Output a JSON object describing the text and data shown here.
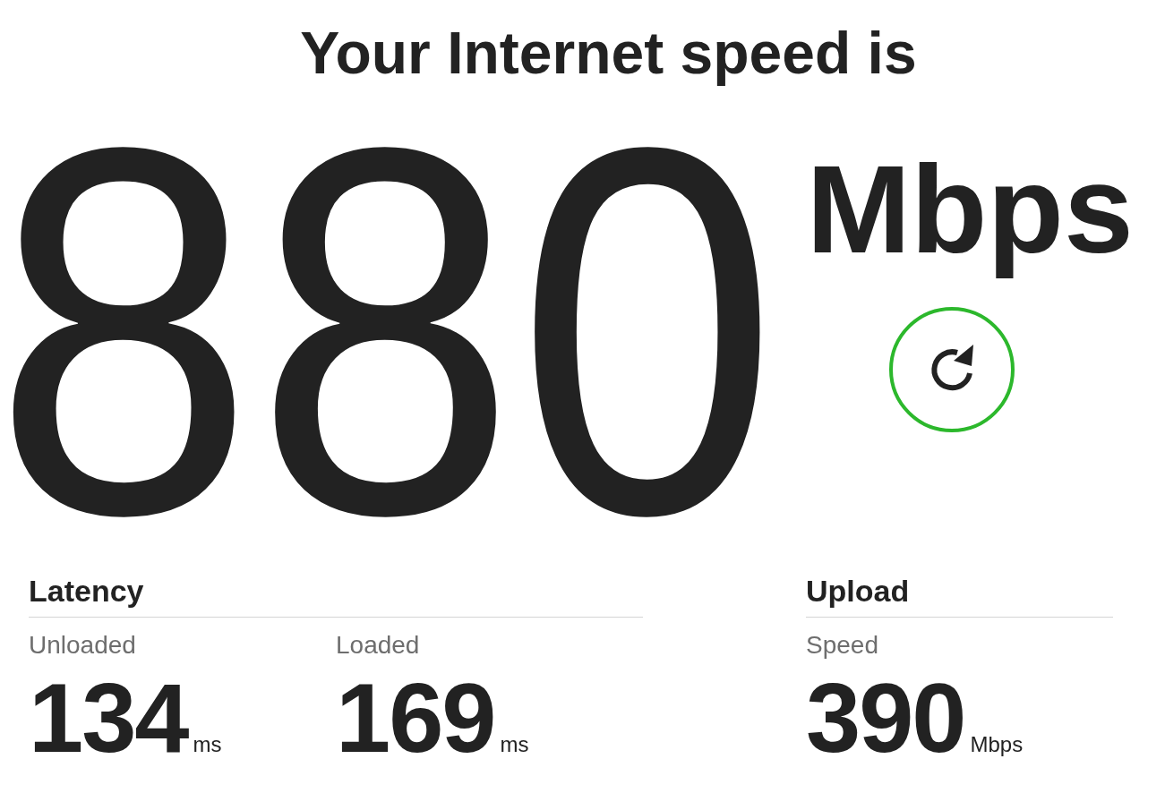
{
  "title": "Your Internet speed is",
  "speed": {
    "value": "880",
    "unit": "Mbps"
  },
  "groups": [
    {
      "heading": "Latency",
      "metrics": [
        {
          "label": "Unloaded",
          "value": "134",
          "unit": "ms"
        },
        {
          "label": "Loaded",
          "value": "169",
          "unit": "ms"
        }
      ]
    },
    {
      "heading": "Upload",
      "metrics": [
        {
          "label": "Speed",
          "value": "390",
          "unit": "Mbps"
        }
      ]
    }
  ]
}
